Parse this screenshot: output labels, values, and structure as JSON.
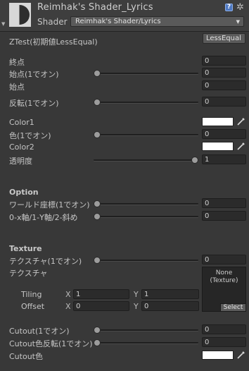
{
  "header": {
    "title": "Reimhak's Shader_Lyrics",
    "shader_label": "Shader",
    "shader_value": "Reimhak's Shader/Lyrics",
    "help_glyph": "?"
  },
  "ztest": {
    "label": "ZTest(初期値LessEqual)",
    "value": "LessEqual"
  },
  "props": {
    "end_point": {
      "label": "終点",
      "value": "0"
    },
    "start_point_toggle": {
      "label": "始点(1でオン)",
      "value": "0",
      "slider": 0
    },
    "start_point": {
      "label": "始点",
      "value": "0"
    },
    "reverse_toggle": {
      "label": "反転(1でオン)",
      "value": "0",
      "slider": 0
    },
    "color1": {
      "label": "Color1",
      "color": "#ffffff"
    },
    "color_toggle": {
      "label": "色(1でオン)",
      "value": "0",
      "slider": 0
    },
    "color2": {
      "label": "Color2",
      "color": "#ffffff"
    },
    "alpha": {
      "label": "透明度",
      "value": "1",
      "slider": 1
    }
  },
  "option": {
    "header": "Option",
    "world_coord": {
      "label": "ワールド座標(1でオン)",
      "value": "0",
      "slider": 0
    },
    "axis": {
      "label": "0-x軸/1-Y軸/2-斜め",
      "value": "0",
      "slider": 0
    }
  },
  "texture": {
    "header": "Texture",
    "toggle": {
      "label": "テクスチャ(1でオン)",
      "value": "0",
      "slider": 0
    },
    "slot_label": "テクスチャ",
    "slot_none": "None\n(Texture)",
    "select_label": "Select",
    "tiling": {
      "label": "Tiling",
      "x_label": "X",
      "x": "1",
      "y_label": "Y",
      "y": "1"
    },
    "offset": {
      "label": "Offset",
      "x_label": "X",
      "x": "0",
      "y_label": "Y",
      "y": "0"
    }
  },
  "cutout": {
    "toggle": {
      "label": "Cutout(1でオン)",
      "value": "0",
      "slider": 0
    },
    "reverse": {
      "label": "Cutout色反転(1でオン)",
      "value": "0",
      "slider": 0
    },
    "color": {
      "label": "Cutout色",
      "color": "#ffffff"
    }
  },
  "icons": [
    "shader-icon",
    "help-icon",
    "gear-icon",
    "dropdown-arrow-icon",
    "collapse-arrow-icon",
    "eyedropper-icon"
  ]
}
